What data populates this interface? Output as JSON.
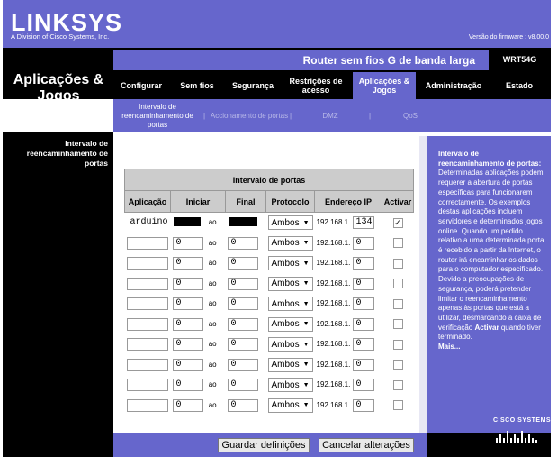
{
  "header": {
    "logo": "LINKSYS",
    "logo_sub": "A Division of Cisco Systems, Inc.",
    "firmware": "Versão do firmware : v8.00.0"
  },
  "section_title": "Aplicações & Jogos",
  "product_name": "Router sem fios G de banda larga",
  "model": "WRT54G",
  "tabs": [
    {
      "label": "Configurar"
    },
    {
      "label": "Sem fios"
    },
    {
      "label": "Segurança"
    },
    {
      "label": "Restrições de acesso"
    },
    {
      "label": "Aplicações & Jogos"
    },
    {
      "label": "Administração"
    },
    {
      "label": "Estado"
    }
  ],
  "subtabs": [
    {
      "label": "Intervalo de reencaminhamento de portas"
    },
    {
      "label": "Accionamento de portas"
    },
    {
      "label": "DMZ"
    },
    {
      "label": "QoS"
    }
  ],
  "left_label": "Intervalo de reencaminhamento de portas",
  "table": {
    "caption": "Intervalo de portas",
    "headers": [
      "Aplicação",
      "Iniciar",
      "Final",
      "Protocolo",
      "Endereço IP",
      "Activar"
    ],
    "to_label": "ao",
    "ip_prefix": "192.168.1.",
    "rows": [
      {
        "app": "arduino",
        "start": "",
        "end": "",
        "protocol": "Ambos",
        "ip": "134",
        "enabled": true
      },
      {
        "app": "",
        "start": "0",
        "end": "0",
        "protocol": "Ambos",
        "ip": "0",
        "enabled": false
      },
      {
        "app": "",
        "start": "0",
        "end": "0",
        "protocol": "Ambos",
        "ip": "0",
        "enabled": false
      },
      {
        "app": "",
        "start": "0",
        "end": "0",
        "protocol": "Ambos",
        "ip": "0",
        "enabled": false
      },
      {
        "app": "",
        "start": "0",
        "end": "0",
        "protocol": "Ambos",
        "ip": "0",
        "enabled": false
      },
      {
        "app": "",
        "start": "0",
        "end": "0",
        "protocol": "Ambos",
        "ip": "0",
        "enabled": false
      },
      {
        "app": "",
        "start": "0",
        "end": "0",
        "protocol": "Ambos",
        "ip": "0",
        "enabled": false
      },
      {
        "app": "",
        "start": "0",
        "end": "0",
        "protocol": "Ambos",
        "ip": "0",
        "enabled": false
      },
      {
        "app": "",
        "start": "0",
        "end": "0",
        "protocol": "Ambos",
        "ip": "0",
        "enabled": false
      },
      {
        "app": "",
        "start": "0",
        "end": "0",
        "protocol": "Ambos",
        "ip": "0",
        "enabled": false
      }
    ]
  },
  "help": {
    "title": "Intervalo de reencaminhamento de portas:",
    "body": "Determinadas aplicações podem requerer a abertura de portas específicas para funcionarem correctamente. Os exemplos destas aplicações incluem servidores e determinados jogos online. Quando um pedido relativo a uma determinada porta é recebido a partir da Internet, o router irá encaminhar os dados para o computador especificado. Devido a preocupações de segurança, poderá pretender limitar o reencaminhamento apenas às portas que está a utilizar, desmarcando a caixa de verificação",
    "bold_word": "Activar",
    "body_end": "quando tiver terminado.",
    "more": "Mais..."
  },
  "cisco_label": "CISCO SYSTEMS",
  "buttons": {
    "save": "Guardar definições",
    "cancel": "Cancelar alterações"
  }
}
